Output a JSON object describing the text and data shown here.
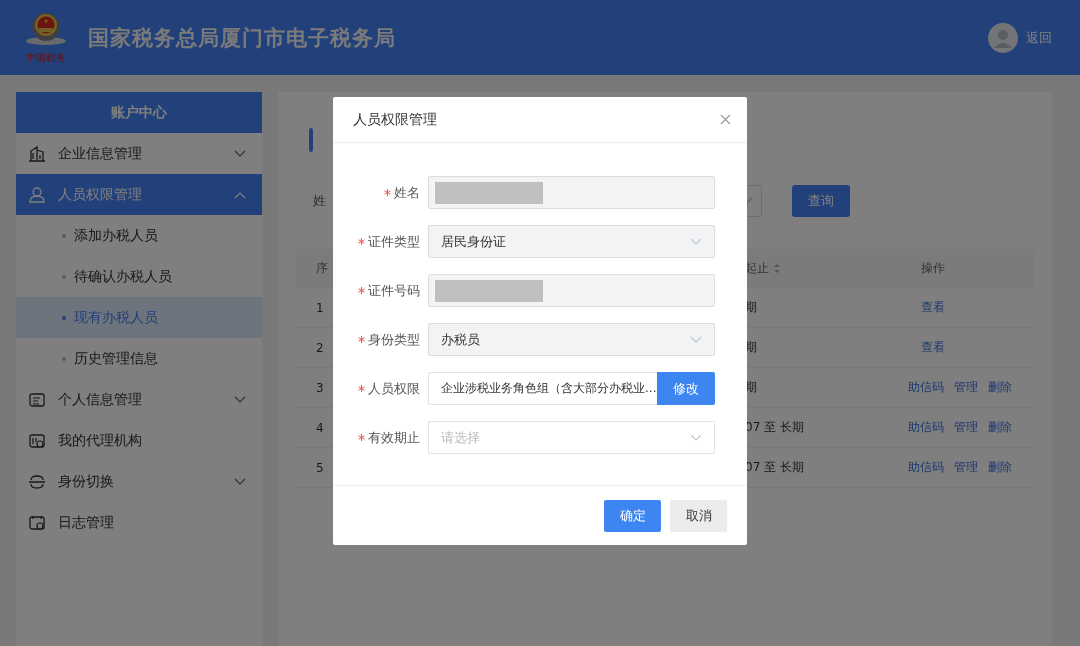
{
  "header": {
    "title": "国家税务总局厦门市电子税务局",
    "logo_caption": "中国税务",
    "back_link": "返回"
  },
  "sidebar": {
    "title": "账户中心",
    "items": [
      {
        "label": "企业信息管理",
        "expanded": false,
        "selected": false
      },
      {
        "label": "人员权限管理",
        "expanded": true,
        "selected": true,
        "children": [
          {
            "label": "添加办税人员",
            "selected": false
          },
          {
            "label": "待确认办税人员",
            "selected": false
          },
          {
            "label": "现有办税人员",
            "selected": true
          },
          {
            "label": "历史管理信息",
            "selected": false
          }
        ]
      },
      {
        "label": "个人信息管理",
        "expanded": false,
        "selected": false
      },
      {
        "label": "我的代理机构",
        "selected": false
      },
      {
        "label": "身份切换",
        "expanded": false,
        "selected": false
      },
      {
        "label": "日志管理",
        "selected": false
      }
    ]
  },
  "main": {
    "filter": {
      "label": "姓",
      "button": "查询"
    },
    "table": {
      "columns": [
        "序",
        "起止",
        "操作"
      ],
      "rows": [
        {
          "cells": [
            "1",
            "期"
          ],
          "actions": [
            "查看"
          ]
        },
        {
          "cells": [
            "2",
            "期"
          ],
          "actions": [
            "查看"
          ]
        },
        {
          "cells": [
            "3",
            "期"
          ],
          "actions": [
            "助信码",
            "管理",
            "删除"
          ]
        },
        {
          "cells": [
            "4",
            "07 至 长期"
          ],
          "actions": [
            "助信码",
            "管理",
            "删除"
          ]
        },
        {
          "cells": [
            "5",
            "07 至 长期"
          ],
          "actions": [
            "助信码",
            "管理",
            "删除"
          ]
        }
      ]
    }
  },
  "modal": {
    "title": "人员权限管理",
    "fields": [
      {
        "label": "姓名",
        "required": true,
        "kind": "input",
        "redacted": true,
        "disabled": true
      },
      {
        "label": "证件类型",
        "required": true,
        "kind": "select",
        "value": "居民身份证",
        "disabled": true
      },
      {
        "label": "证件号码",
        "required": true,
        "kind": "input",
        "redacted": true,
        "disabled": true
      },
      {
        "label": "身份类型",
        "required": true,
        "kind": "select",
        "value": "办税员",
        "disabled": true
      },
      {
        "label": "人员权限",
        "required": true,
        "kind": "button-input",
        "value": "企业涉税业务角色组（含大部分办税业...",
        "button": "修改",
        "disabled": false
      },
      {
        "label": "有效期止",
        "required": true,
        "kind": "select",
        "placeholder": "请选择",
        "disabled": false
      }
    ],
    "buttons": [
      {
        "label": "确定",
        "primary": true
      },
      {
        "label": "取消",
        "primary": false
      }
    ]
  }
}
